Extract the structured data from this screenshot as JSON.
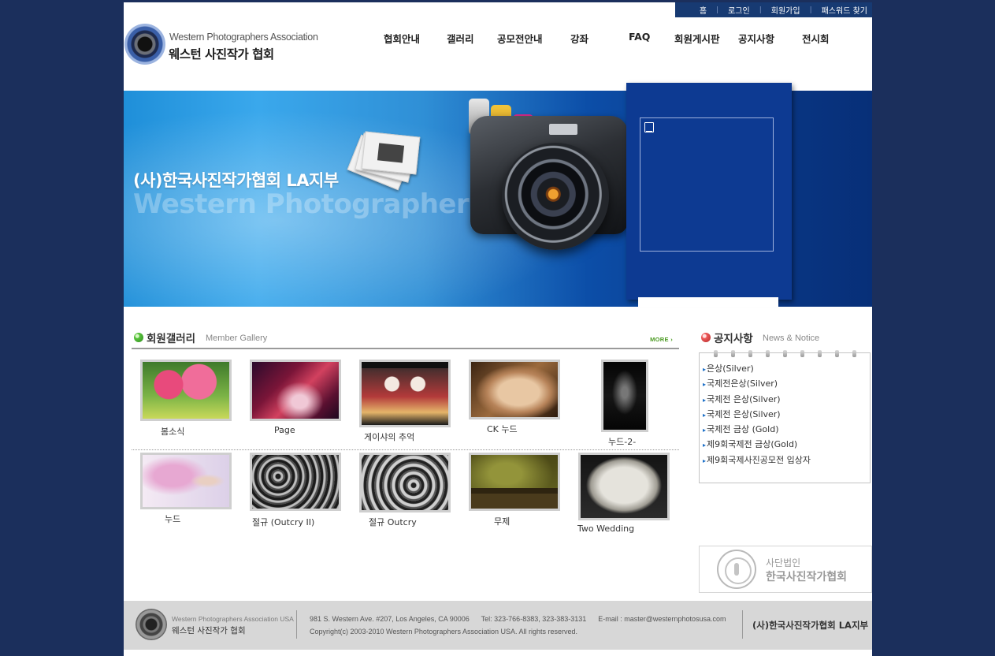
{
  "util_nav": [
    "홈",
    "로그인",
    "회원가입",
    "패스워드 찾기"
  ],
  "logo": {
    "en": "Western Photographers Association",
    "ko": "웨스턴 사진작가 협회"
  },
  "main_nav": [
    "협회안내",
    "갤러리",
    "공모전안내",
    "강좌",
    "FAQ",
    "회원게시판",
    "공지사항",
    "전시회"
  ],
  "hero": {
    "title": "(사)한국사진작가협회 LA지부",
    "subtitle": "Western Photographers Association"
  },
  "gallery": {
    "title_ko": "회원갤러리",
    "title_en": "Member Gallery",
    "more": "MORE",
    "items": [
      {
        "caption": "봄소식"
      },
      {
        "caption": "Page"
      },
      {
        "caption": "게이샤의 추억"
      },
      {
        "caption": "CK 누드"
      },
      {
        "caption": "누드-2-"
      },
      {
        "caption": "누드"
      },
      {
        "caption": "절규 (Outcry II)"
      },
      {
        "caption": "절규 Outcry"
      },
      {
        "caption": "무제"
      },
      {
        "caption": "Two Wedding"
      }
    ]
  },
  "notice": {
    "title_ko": "공지사항",
    "title_en": "News & Notice",
    "items": [
      "은상(Silver)",
      "국제전은상(Silver)",
      "국제전 은상(Silver)",
      "국제전 은상(Silver)",
      "국제전 금상 (Gold)",
      "제9회국제전 금상(Gold)",
      "제9회국제사진공모전 입상자"
    ]
  },
  "badge": {
    "line1": "사단법인",
    "line2": "한국사진작가협회"
  },
  "footer": {
    "logo_en": "Western Photographers Association USA",
    "logo_ko": "웨스턴 사진작가 협회",
    "address": "981 S. Western Ave. #207, Los Angeles, CA 90006",
    "tel": "Tel: 323-766-8383, 323-383-3131",
    "email": "E-mail : master@westernphotosusa.com",
    "copyright": "Copyright(c) 2003-2010 Western Photographers Association USA. All rights reserved.",
    "org_name": "(사)한국사진작가협회 LA지부"
  },
  "colors": {
    "background": "#1b2f5c",
    "util_bar": "#173a72",
    "popup": "#0d3a92",
    "footer": "#d7d7d7",
    "more": "#4a9a21"
  }
}
